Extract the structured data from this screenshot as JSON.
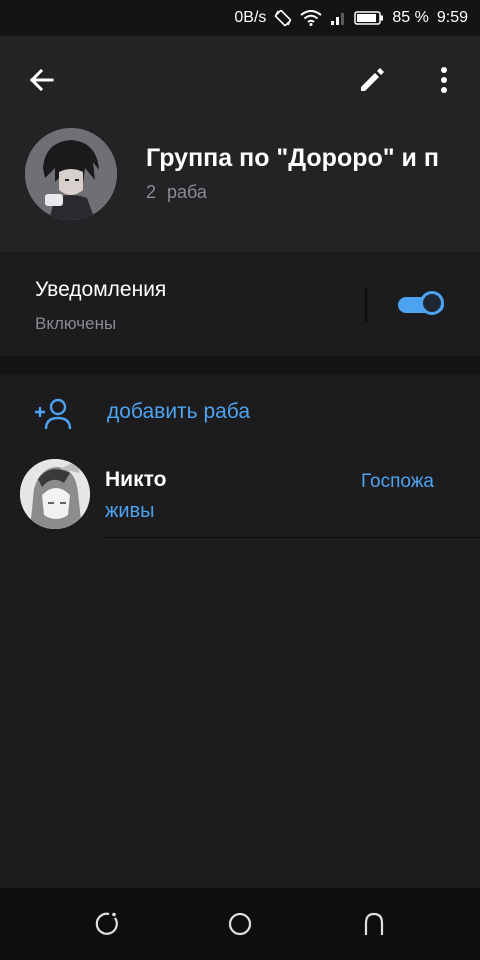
{
  "status_bar": {
    "net_speed": "0B/s",
    "battery": "85 %",
    "time": "9:59"
  },
  "header": {
    "title": "Группа по \"Дороро\" и п",
    "subtitle": "2 раба"
  },
  "notifications": {
    "title": "Уведомления",
    "status": "Включены",
    "enabled": true
  },
  "members": {
    "add_label": "добавить раба",
    "items": [
      {
        "name": "Никто",
        "status": "живы",
        "role": "Госпожа"
      }
    ]
  },
  "colors": {
    "accent": "#4ea3f0",
    "background": "#1c1c1f",
    "header": "#232326",
    "secondary_text": "#8a8a90"
  },
  "icons": {
    "back": "arrow-left-icon",
    "edit": "pencil-icon",
    "more": "more-vertical-icon",
    "add_member": "person-add-icon",
    "nav_recent": "recent-apps-icon",
    "nav_home": "home-icon",
    "nav_back": "nav-back-icon"
  }
}
